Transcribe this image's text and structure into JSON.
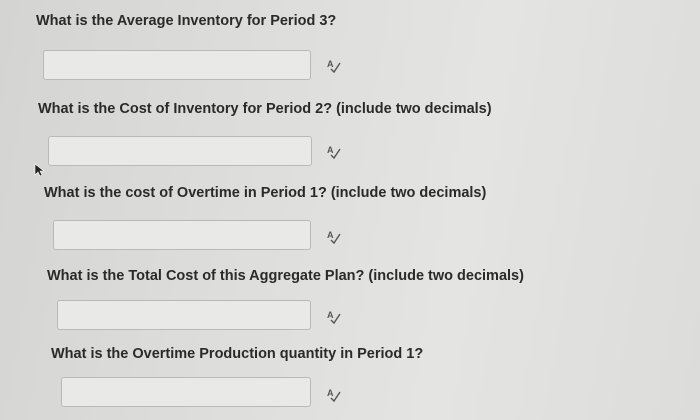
{
  "questions": [
    {
      "label": "What is the Average Inventory for Period 3?",
      "value": ""
    },
    {
      "label": "What is the Cost of Inventory for Period 2? (include two decimals)",
      "value": ""
    },
    {
      "label": "What is the cost of Overtime in Period 1? (include two decimals)",
      "value": ""
    },
    {
      "label": "What is the Total Cost of this Aggregate Plan? (include two decimals)",
      "value": ""
    },
    {
      "label": "What is the Overtime Production quantity in Period 1?",
      "value": ""
    }
  ],
  "icons": {
    "spellcheck": "spellcheck-icon",
    "cursor": "cursor-icon"
  }
}
